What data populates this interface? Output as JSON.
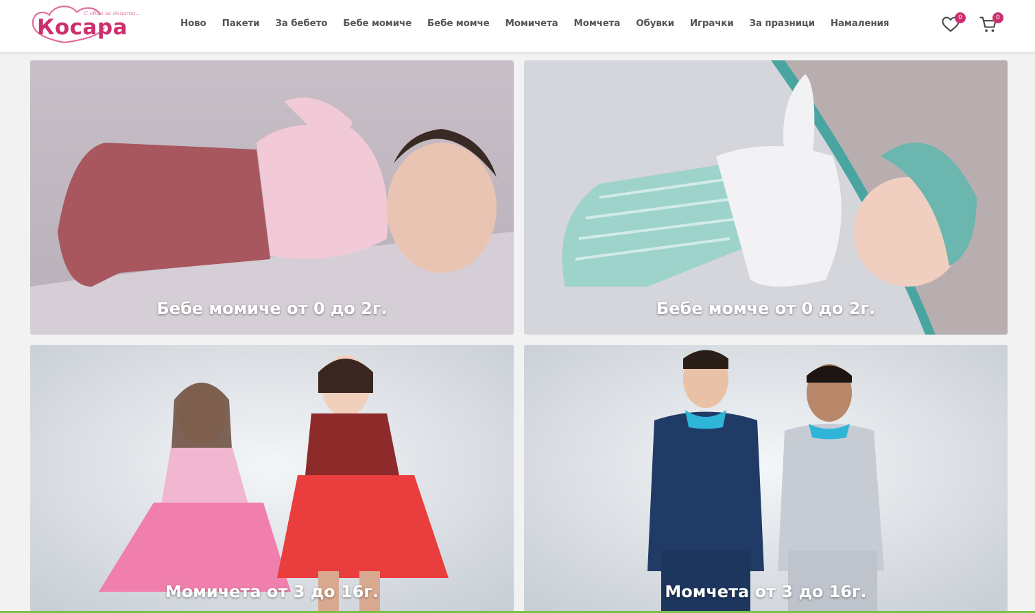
{
  "header": {
    "logo": {
      "name": "Косара",
      "tagline": "С обич за децата..."
    },
    "nav": [
      "Ново",
      "Пакети",
      "За бебето",
      "Бебе момиче",
      "Бебе момче",
      "Момичета",
      "Момчета",
      "Обувки",
      "Играчки",
      "За празници",
      "Намаления"
    ],
    "wishlist_count": "0",
    "cart_count": "0"
  },
  "cards": [
    {
      "caption": "Бебе момиче от 0 до 2г.",
      "image": "baby-girl-photo"
    },
    {
      "caption": "Бебе момче от 0 до 2г.",
      "image": "baby-boy-photo"
    },
    {
      "caption": "Момичета от 3 до 16г.",
      "image": "girls-photo"
    },
    {
      "caption": "Момчета от 3 до 16г.",
      "image": "boys-photo"
    }
  ],
  "colors": {
    "brand": "#cc2f6e",
    "nav_text": "#555555",
    "accent_green": "#7cc04b"
  }
}
